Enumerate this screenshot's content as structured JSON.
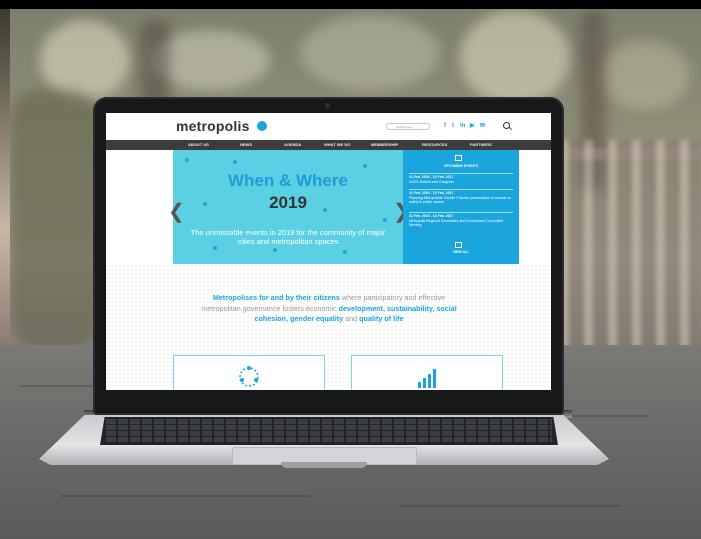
{
  "site": {
    "logo": "metropolis",
    "search_placeholder": "Search here",
    "social_icons": [
      "facebook-icon",
      "twitter-icon",
      "linkedin-icon",
      "youtube-icon",
      "email-icon"
    ],
    "social_glyphs": [
      "f",
      "t",
      "in",
      "▶",
      "✉"
    ],
    "accent_color": "#1aa6dc",
    "nav": [
      "ABOUT US",
      "NEWS",
      "AGENDA",
      "WHAT WE DO",
      "MEMBERSHIP",
      "RESOURCES",
      "PARTNERS"
    ],
    "hero": {
      "title": "When & Where",
      "year": "2019",
      "subtitle": "The unmissable events in 2019 for the community of major cities and metropolitan spaces",
      "prev_arrow": "❮",
      "next_arrow": "❯",
      "background_color": "#5bd0e3"
    },
    "upcoming": {
      "title": "UPCOMING EVENTS",
      "events": [
        {
          "date": "11 Feb. 2019 - 13 Feb. 2017",
          "title": "UrCiG Retreat and Congress"
        },
        {
          "date": "11 Feb. 2019 - 13 Feb. 2017",
          "title": "Planning Metropolitan Gender Policies: presentation of manual on safety in public spaces"
        },
        {
          "date": "11 Feb. 2019 - 13 Feb. 2017",
          "title": "Metropolis Regional Secretaries and Governance Committee Meeting"
        }
      ],
      "view_all": "VIEW ALL"
    },
    "mission": {
      "part1": "Metropolises for and by their citizens",
      "part2": " where participatory and effective metropolitan governance fosters economic ",
      "part3": "development, sustainability, social cohesion, gender equality",
      "part4": " and ",
      "part5": "quality of life"
    }
  }
}
